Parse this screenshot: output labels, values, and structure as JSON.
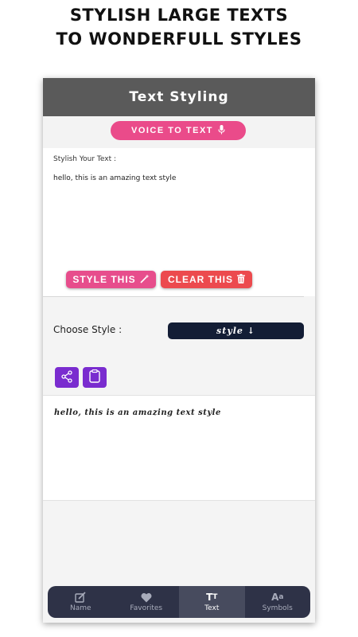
{
  "promo": {
    "line1": "STYLISH LARGE TEXTS",
    "line2": "TO WONDERFULL STYLES"
  },
  "appbar": {
    "title": "Text Styling"
  },
  "voice": {
    "label": "VOICE TO TEXT",
    "icon": "microphone-icon"
  },
  "input": {
    "label": "Stylish Your Text :",
    "value": "hello, this is an amazing text style"
  },
  "actions": {
    "style_label": "STYLE THIS",
    "style_icon": "magic-wand-icon",
    "clear_label": "CLEAR THIS",
    "clear_icon": "trash-icon"
  },
  "style_picker": {
    "label": "Choose Style :",
    "selected": "style ↓"
  },
  "tools": {
    "share_icon": "share-icon",
    "copy_icon": "clipboard-icon"
  },
  "output": {
    "text": "hello, this is an amazing text style"
  },
  "nav": {
    "items": [
      {
        "label": "Name",
        "icon": "edit-icon",
        "active": false
      },
      {
        "label": "Favorites",
        "icon": "heart-icon",
        "active": false
      },
      {
        "label": "Text",
        "icon": "text-size-icon",
        "active": true
      },
      {
        "label": "Symbols",
        "icon": "font-aa-icon",
        "active": false
      }
    ]
  },
  "colors": {
    "appbar": "#5a5a5a",
    "voice_button": "#ea4b8a",
    "style_button": "#e74d8c",
    "clear_button": "#ec4a4e",
    "style_select": "#131d35",
    "tool_button": "#7a2ccf",
    "bottom_nav": "#2e3247"
  }
}
